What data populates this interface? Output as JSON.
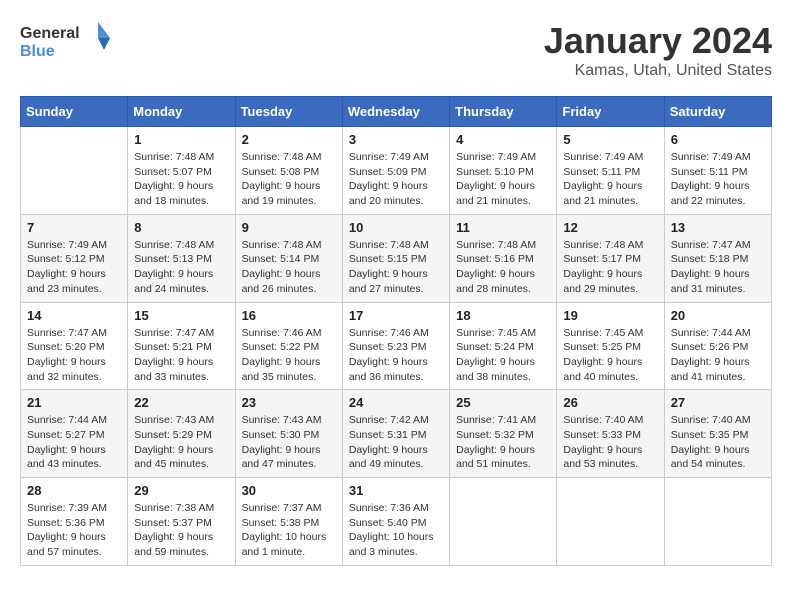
{
  "header": {
    "logo_general": "General",
    "logo_blue": "Blue",
    "month": "January 2024",
    "location": "Kamas, Utah, United States"
  },
  "weekdays": [
    "Sunday",
    "Monday",
    "Tuesday",
    "Wednesday",
    "Thursday",
    "Friday",
    "Saturday"
  ],
  "weeks": [
    [
      {
        "day": "",
        "sunrise": "",
        "sunset": "",
        "daylight": ""
      },
      {
        "day": "1",
        "sunrise": "Sunrise: 7:48 AM",
        "sunset": "Sunset: 5:07 PM",
        "daylight": "Daylight: 9 hours and 18 minutes."
      },
      {
        "day": "2",
        "sunrise": "Sunrise: 7:48 AM",
        "sunset": "Sunset: 5:08 PM",
        "daylight": "Daylight: 9 hours and 19 minutes."
      },
      {
        "day": "3",
        "sunrise": "Sunrise: 7:49 AM",
        "sunset": "Sunset: 5:09 PM",
        "daylight": "Daylight: 9 hours and 20 minutes."
      },
      {
        "day": "4",
        "sunrise": "Sunrise: 7:49 AM",
        "sunset": "Sunset: 5:10 PM",
        "daylight": "Daylight: 9 hours and 21 minutes."
      },
      {
        "day": "5",
        "sunrise": "Sunrise: 7:49 AM",
        "sunset": "Sunset: 5:11 PM",
        "daylight": "Daylight: 9 hours and 21 minutes."
      },
      {
        "day": "6",
        "sunrise": "Sunrise: 7:49 AM",
        "sunset": "Sunset: 5:11 PM",
        "daylight": "Daylight: 9 hours and 22 minutes."
      }
    ],
    [
      {
        "day": "7",
        "sunrise": "Sunrise: 7:49 AM",
        "sunset": "Sunset: 5:12 PM",
        "daylight": "Daylight: 9 hours and 23 minutes."
      },
      {
        "day": "8",
        "sunrise": "Sunrise: 7:48 AM",
        "sunset": "Sunset: 5:13 PM",
        "daylight": "Daylight: 9 hours and 24 minutes."
      },
      {
        "day": "9",
        "sunrise": "Sunrise: 7:48 AM",
        "sunset": "Sunset: 5:14 PM",
        "daylight": "Daylight: 9 hours and 26 minutes."
      },
      {
        "day": "10",
        "sunrise": "Sunrise: 7:48 AM",
        "sunset": "Sunset: 5:15 PM",
        "daylight": "Daylight: 9 hours and 27 minutes."
      },
      {
        "day": "11",
        "sunrise": "Sunrise: 7:48 AM",
        "sunset": "Sunset: 5:16 PM",
        "daylight": "Daylight: 9 hours and 28 minutes."
      },
      {
        "day": "12",
        "sunrise": "Sunrise: 7:48 AM",
        "sunset": "Sunset: 5:17 PM",
        "daylight": "Daylight: 9 hours and 29 minutes."
      },
      {
        "day": "13",
        "sunrise": "Sunrise: 7:47 AM",
        "sunset": "Sunset: 5:18 PM",
        "daylight": "Daylight: 9 hours and 31 minutes."
      }
    ],
    [
      {
        "day": "14",
        "sunrise": "Sunrise: 7:47 AM",
        "sunset": "Sunset: 5:20 PM",
        "daylight": "Daylight: 9 hours and 32 minutes."
      },
      {
        "day": "15",
        "sunrise": "Sunrise: 7:47 AM",
        "sunset": "Sunset: 5:21 PM",
        "daylight": "Daylight: 9 hours and 33 minutes."
      },
      {
        "day": "16",
        "sunrise": "Sunrise: 7:46 AM",
        "sunset": "Sunset: 5:22 PM",
        "daylight": "Daylight: 9 hours and 35 minutes."
      },
      {
        "day": "17",
        "sunrise": "Sunrise: 7:46 AM",
        "sunset": "Sunset: 5:23 PM",
        "daylight": "Daylight: 9 hours and 36 minutes."
      },
      {
        "day": "18",
        "sunrise": "Sunrise: 7:45 AM",
        "sunset": "Sunset: 5:24 PM",
        "daylight": "Daylight: 9 hours and 38 minutes."
      },
      {
        "day": "19",
        "sunrise": "Sunrise: 7:45 AM",
        "sunset": "Sunset: 5:25 PM",
        "daylight": "Daylight: 9 hours and 40 minutes."
      },
      {
        "day": "20",
        "sunrise": "Sunrise: 7:44 AM",
        "sunset": "Sunset: 5:26 PM",
        "daylight": "Daylight: 9 hours and 41 minutes."
      }
    ],
    [
      {
        "day": "21",
        "sunrise": "Sunrise: 7:44 AM",
        "sunset": "Sunset: 5:27 PM",
        "daylight": "Daylight: 9 hours and 43 minutes."
      },
      {
        "day": "22",
        "sunrise": "Sunrise: 7:43 AM",
        "sunset": "Sunset: 5:29 PM",
        "daylight": "Daylight: 9 hours and 45 minutes."
      },
      {
        "day": "23",
        "sunrise": "Sunrise: 7:43 AM",
        "sunset": "Sunset: 5:30 PM",
        "daylight": "Daylight: 9 hours and 47 minutes."
      },
      {
        "day": "24",
        "sunrise": "Sunrise: 7:42 AM",
        "sunset": "Sunset: 5:31 PM",
        "daylight": "Daylight: 9 hours and 49 minutes."
      },
      {
        "day": "25",
        "sunrise": "Sunrise: 7:41 AM",
        "sunset": "Sunset: 5:32 PM",
        "daylight": "Daylight: 9 hours and 51 minutes."
      },
      {
        "day": "26",
        "sunrise": "Sunrise: 7:40 AM",
        "sunset": "Sunset: 5:33 PM",
        "daylight": "Daylight: 9 hours and 53 minutes."
      },
      {
        "day": "27",
        "sunrise": "Sunrise: 7:40 AM",
        "sunset": "Sunset: 5:35 PM",
        "daylight": "Daylight: 9 hours and 54 minutes."
      }
    ],
    [
      {
        "day": "28",
        "sunrise": "Sunrise: 7:39 AM",
        "sunset": "Sunset: 5:36 PM",
        "daylight": "Daylight: 9 hours and 57 minutes."
      },
      {
        "day": "29",
        "sunrise": "Sunrise: 7:38 AM",
        "sunset": "Sunset: 5:37 PM",
        "daylight": "Daylight: 9 hours and 59 minutes."
      },
      {
        "day": "30",
        "sunrise": "Sunrise: 7:37 AM",
        "sunset": "Sunset: 5:38 PM",
        "daylight": "Daylight: 10 hours and 1 minute."
      },
      {
        "day": "31",
        "sunrise": "Sunrise: 7:36 AM",
        "sunset": "Sunset: 5:40 PM",
        "daylight": "Daylight: 10 hours and 3 minutes."
      },
      {
        "day": "",
        "sunrise": "",
        "sunset": "",
        "daylight": ""
      },
      {
        "day": "",
        "sunrise": "",
        "sunset": "",
        "daylight": ""
      },
      {
        "day": "",
        "sunrise": "",
        "sunset": "",
        "daylight": ""
      }
    ]
  ]
}
